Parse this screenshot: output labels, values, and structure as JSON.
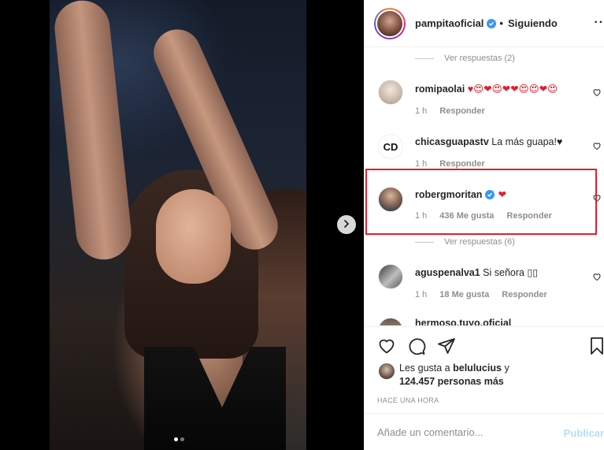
{
  "header": {
    "username": "pampitaoficial",
    "separator": "•",
    "follow_status": "Siguiendo",
    "more": "··"
  },
  "comments": [
    {
      "type": "replies",
      "label": "Ver respuestas (2)"
    },
    {
      "type": "comment",
      "username": "romipaolai",
      "text": "♥😍❤😍❤❤😍😍❤😍",
      "time": "1 h",
      "likes": "",
      "reply": "Responder"
    },
    {
      "type": "comment",
      "username": "chicasguapastv",
      "text": "La más guapa!♥",
      "time": "1 h",
      "likes": "",
      "reply": "Responder"
    },
    {
      "type": "comment",
      "username": "robergmoritan",
      "text": "❤",
      "time": "1 h",
      "likes": "436 Me gusta",
      "reply": "Responder"
    },
    {
      "type": "replies",
      "label": "Ver respuestas (6)"
    },
    {
      "type": "comment",
      "username": "aguspenalva1",
      "text": "Si señora ▯▯",
      "time": "1 h",
      "likes": "18 Me gusta",
      "reply": "Responder"
    },
    {
      "type": "comment",
      "username": "hermoso.tuyo.oficial",
      "text": "",
      "time": "",
      "likes": "",
      "reply": ""
    }
  ],
  "likes": {
    "prefix": "Les gusta a",
    "user": "belulucius",
    "connector": "y",
    "count": "124.457 personas más"
  },
  "post_time": "HACE UNA HORA",
  "composer": {
    "placeholder": "Añade un comentario...",
    "publish": "Publicar"
  },
  "colors": {
    "verified": "#3897f0",
    "highlight": "#e0202e",
    "heart": "#e0202e"
  },
  "icons": [
    "chevron-right-icon",
    "heart-icon",
    "comment-icon",
    "share-icon",
    "bookmark-icon",
    "verified-icon"
  ]
}
